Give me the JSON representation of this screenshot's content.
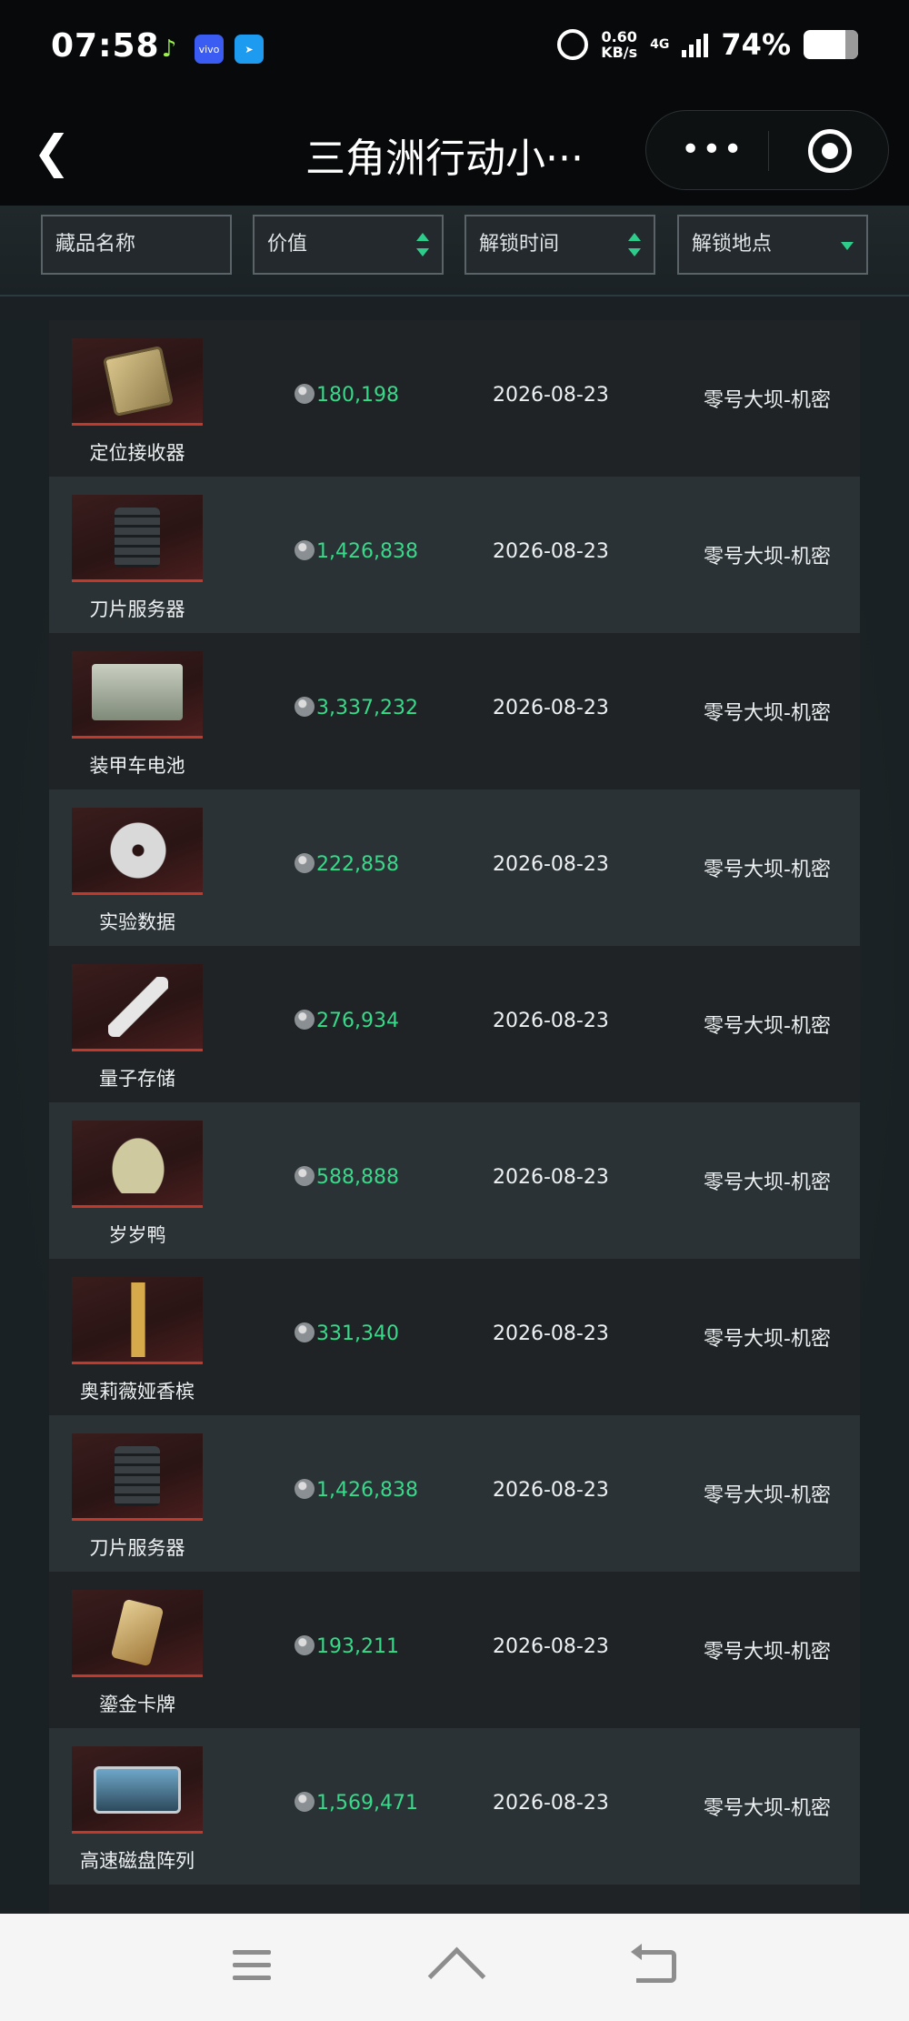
{
  "status_bar": {
    "time": "07:58",
    "app_icons": [
      "music-app-icon",
      "vivo-app-icon",
      "telegram-app-icon"
    ],
    "vivo_label": "vivo",
    "net_speed_value": "0.60",
    "net_speed_unit": "KB/s",
    "network": "4G",
    "battery": "74%"
  },
  "nav": {
    "title": "三角洲行动小···",
    "more_icon": "more-dots-icon",
    "target_icon": "target-icon"
  },
  "filters": {
    "name": "藏品名称",
    "value": "价值",
    "unlock_time": "解锁时间",
    "unlock_place": "解锁地点"
  },
  "items": [
    {
      "name": "定位接收器",
      "value": "180,198",
      "date": "2026-08-23",
      "place": "零号大坝-机密",
      "icon": "locator-receiver"
    },
    {
      "name": "刀片服务器",
      "value": "1,426,838",
      "date": "2026-08-23",
      "place": "零号大坝-机密",
      "icon": "blade-server"
    },
    {
      "name": "装甲车电池",
      "value": "3,337,232",
      "date": "2026-08-23",
      "place": "零号大坝-机密",
      "icon": "armored-battery"
    },
    {
      "name": "实验数据",
      "value": "222,858",
      "date": "2026-08-23",
      "place": "零号大坝-机密",
      "icon": "data-disk"
    },
    {
      "name": "量子存储",
      "value": "276,934",
      "date": "2026-08-23",
      "place": "零号大坝-机密",
      "icon": "quantum-storage"
    },
    {
      "name": "岁岁鸭",
      "value": "588,888",
      "date": "2026-08-23",
      "place": "零号大坝-机密",
      "icon": "duck-figurine"
    },
    {
      "name": "奥莉薇娅香槟",
      "value": "331,340",
      "date": "2026-08-23",
      "place": "零号大坝-机密",
      "icon": "champagne-bottle"
    },
    {
      "name": "刀片服务器",
      "value": "1,426,838",
      "date": "2026-08-23",
      "place": "零号大坝-机密",
      "icon": "blade-server"
    },
    {
      "name": "鎏金卡牌",
      "value": "193,211",
      "date": "2026-08-23",
      "place": "零号大坝-机密",
      "icon": "gold-card"
    },
    {
      "name": "高速磁盘阵列",
      "value": "1,569,471",
      "date": "2026-08-23",
      "place": "零号大坝-机密",
      "icon": "disk-array"
    }
  ],
  "colors": {
    "accent_green": "#39d98a",
    "thumb_underline": "#c0392b"
  }
}
